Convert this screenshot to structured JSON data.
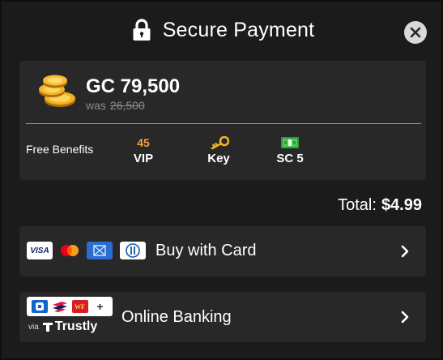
{
  "header": {
    "title": "Secure Payment",
    "lock_icon": "lock-icon",
    "close_icon": "close-icon"
  },
  "package": {
    "currency_amount": "GC 79,500",
    "was_label": "was",
    "was_amount": "26,500",
    "icon": "gold-coins-icon"
  },
  "benefits": {
    "label": "Free Benefits",
    "items": [
      {
        "top": "45",
        "label": "VIP",
        "icon": null
      },
      {
        "top": "",
        "label": "Key",
        "icon": "key-icon"
      },
      {
        "top": "",
        "label": "SC 5",
        "icon": "cash-icon"
      }
    ]
  },
  "total": {
    "label": "Total:",
    "amount": "$4.99"
  },
  "payment_options": [
    {
      "label": "Buy with Card",
      "logos": [
        "visa-logo",
        "mastercard-logo",
        "amex-logo",
        "diners-club-logo"
      ],
      "visa_text": "VISA"
    },
    {
      "label": "Online Banking",
      "logos": [
        "chase-logo",
        "bank-of-america-logo",
        "wells-fargo-logo",
        "more-banks-icon"
      ],
      "wf_text": "WF",
      "plus_text": "+",
      "via_text": "via",
      "provider": "Trustly"
    }
  ],
  "colors": {
    "background": "#1b1b1b",
    "card": "#282828",
    "accent_orange": "#f2a23c",
    "muted_text": "#8c8c8c"
  }
}
